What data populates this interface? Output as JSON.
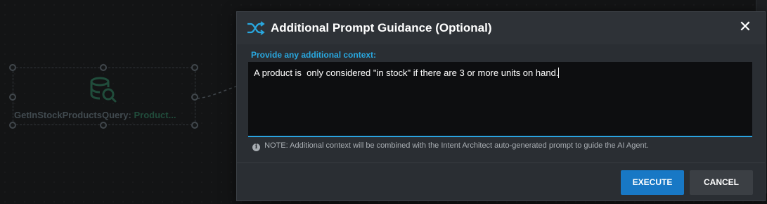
{
  "background": {
    "node": {
      "name": "GetInStockProductsQuery:",
      "type": "Product..."
    }
  },
  "dialog": {
    "title": "Additional Prompt Guidance (Optional)",
    "close_glyph": "✕",
    "field_label": "Provide any additional context:",
    "text_value": "A product is  only considered \"in stock\" if there are 3 or more units on hand.",
    "note_icon": "i",
    "note": "NOTE: Additional context will be combined with the Intent Architect auto-generated prompt to guide the AI Agent.",
    "buttons": {
      "execute": "EXECUTE",
      "cancel": "CANCEL"
    }
  },
  "colors": {
    "accent": "#29a8e0",
    "primary_button": "#1878c5",
    "secondary_button": "#3b3f44"
  },
  "icons": {
    "header": "shuffle-icon",
    "node": "database-search-icon",
    "close": "close-icon",
    "note": "info-icon"
  }
}
